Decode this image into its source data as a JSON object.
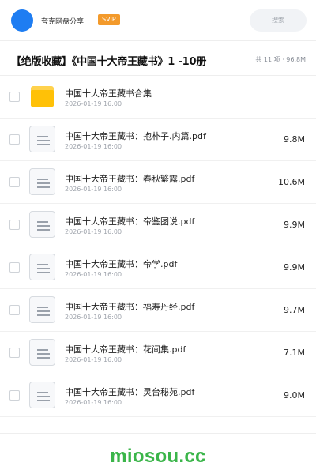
{
  "header": {
    "app_name": "夸克网盘分享",
    "badge": "SVIP",
    "search_placeholder": "搜索",
    "brand_color": "#1e7df2",
    "badge_color": "#f39a2b"
  },
  "share": {
    "title": "【绝版收藏】《中国十大帝王藏书》1 -10册",
    "meta": "共 11 项 · 96.8M"
  },
  "files": [
    {
      "icon": "folder-icon",
      "name": "中国十大帝王藏书合集",
      "date": "2026-01-19 16:00",
      "size": ""
    },
    {
      "icon": "document-icon",
      "name": "中国十大帝王藏书：抱朴子.内篇.pdf",
      "date": "2026-01-19 16:00",
      "size": "9.8M"
    },
    {
      "icon": "document-icon",
      "name": "中国十大帝王藏书：春秋繁露.pdf",
      "date": "2026-01-19 16:00",
      "size": "10.6M"
    },
    {
      "icon": "document-icon",
      "name": "中国十大帝王藏书：帝鉴图说.pdf",
      "date": "2026-01-19 16:00",
      "size": "9.9M"
    },
    {
      "icon": "document-icon",
      "name": "中国十大帝王藏书：帝学.pdf",
      "date": "2026-01-19 16:00",
      "size": "9.9M"
    },
    {
      "icon": "document-icon",
      "name": "中国十大帝王藏书：福寿丹经.pdf",
      "date": "2026-01-19 16:00",
      "size": "9.7M"
    },
    {
      "icon": "document-icon",
      "name": "中国十大帝王藏书：花间集.pdf",
      "date": "2026-01-19 16:00",
      "size": "7.1M"
    },
    {
      "icon": "document-icon",
      "name": "中国十大帝王藏书：灵台秘苑.pdf",
      "date": "2026-01-19 16:00",
      "size": "9.0M"
    }
  ],
  "footer": {
    "watermark": "miosou.cc",
    "watermark_color": "#3bb54a"
  }
}
